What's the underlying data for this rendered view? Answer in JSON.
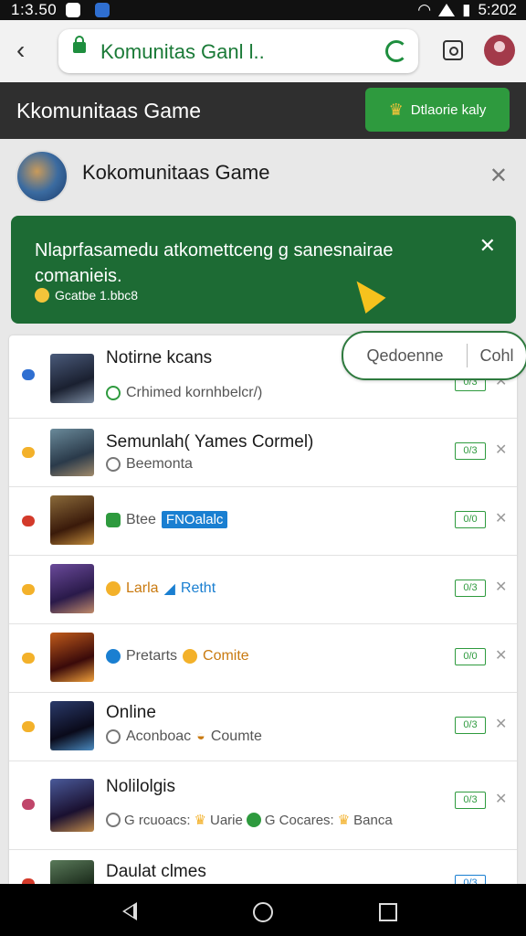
{
  "status_bar": {
    "time": "1:3.50",
    "battery_time": "5:202"
  },
  "browser": {
    "url_text": "Komunitas Ganl l.."
  },
  "app_header": {
    "title": "Kkomunitaas Game",
    "action_label": "Dtlaorie kaly"
  },
  "group": {
    "name": "Kokomunitaas Game"
  },
  "banner": {
    "message": "Nlaprfasamedu atkomettceng g sanesnairae comanieis.",
    "meta_text": "Gcatbe 1.bbc8"
  },
  "pill": {
    "left_label": "Qedoenne",
    "right_label": "Cohl"
  },
  "list_items": [
    {
      "title": "Notirne kcans",
      "sub": [
        "Crhimed kornhbelcr/)"
      ],
      "badge": "0/3",
      "mark_color": "#2f6fd1"
    },
    {
      "title": "Semunlah( Yames Cormel)",
      "sub": [
        "Beemonta"
      ],
      "badge": "0/3",
      "mark_color": "#f3b12a"
    },
    {
      "title": "",
      "sub": [
        "Btee",
        "FNOalalc"
      ],
      "badge": "0/0",
      "mark_color": "#d33a2a"
    },
    {
      "title": "",
      "sub": [
        "Larla",
        "Retht"
      ],
      "badge": "0/3",
      "mark_color": "#f3b12a"
    },
    {
      "title": "",
      "sub": [
        "Pretarts",
        "Comite"
      ],
      "badge": "0/0",
      "mark_color": "#f3b12a"
    },
    {
      "title": "Online",
      "sub": [
        "Aconboac",
        "Coumte"
      ],
      "badge": "0/3",
      "mark_color": "#f3b12a"
    },
    {
      "title": "Nolilolgis",
      "sub": [
        "G rcuoacs:",
        "Uarie",
        "G Cocares:",
        "Banca"
      ],
      "badge": "0/3",
      "mark_color": "#c0456a"
    },
    {
      "title": "Daulat clmes",
      "sub": [],
      "badge": "0/3",
      "mark_color": "#d33a2a"
    }
  ],
  "colors": {
    "accent_green": "#2e9a3e",
    "banner_green": "#1d6b34",
    "header_dark": "#2f2f2f",
    "tag_blue": "#1a7fd1"
  }
}
